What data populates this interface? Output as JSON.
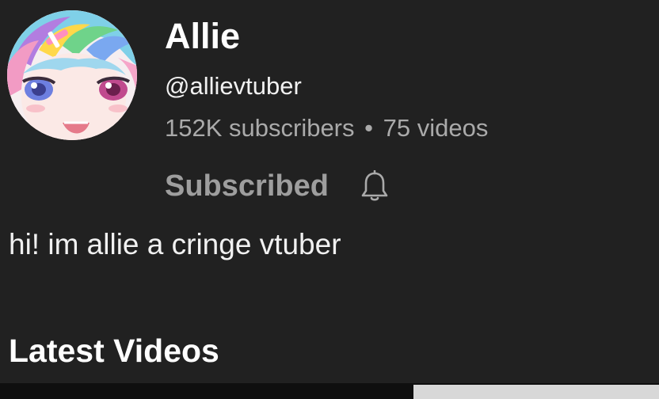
{
  "channel": {
    "name": "Allie",
    "handle": "@allievtuber",
    "subscribers": "152K subscribers",
    "separator": "•",
    "videos": "75 videos",
    "subscribe_label": "Subscribed",
    "description": "hi! im allie a cringe vtuber"
  },
  "sections": {
    "latest_title": "Latest Videos"
  },
  "icons": {
    "avatar": "avatar-anime-girl",
    "notifications": "bell-icon"
  },
  "colors": {
    "background": "#212121",
    "primary_text": "#ffffff",
    "secondary_text": "#aaaaaa",
    "subscribed_text": "#9e9e9e"
  }
}
